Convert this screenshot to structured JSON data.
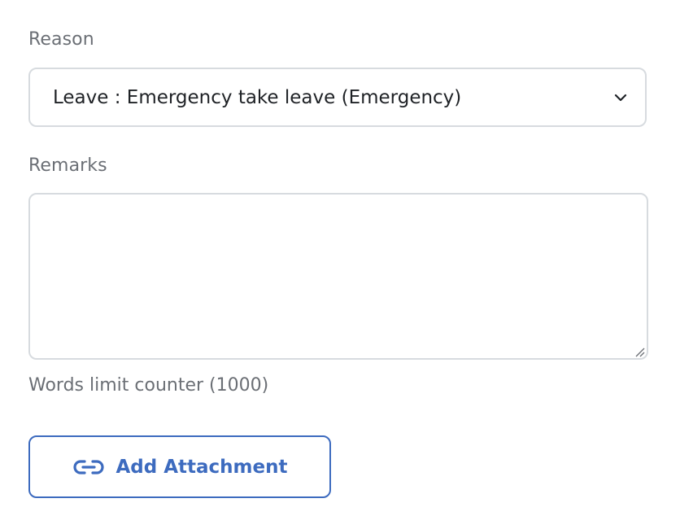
{
  "reason": {
    "label": "Reason",
    "selected_value": "Leave : Emergency take leave (Emergency)",
    "icon": "chevron-down-icon"
  },
  "remarks": {
    "label": "Remarks",
    "value": "",
    "counter_text": "Words limit counter (1000)"
  },
  "attachment": {
    "button_label": "Add Attachment",
    "icon": "link-icon",
    "accent_color": "#3d6bbf"
  },
  "colors": {
    "label": "#6b6f75",
    "border": "#d7dbdf",
    "text": "#1f2226",
    "accent": "#3d6bbf"
  }
}
